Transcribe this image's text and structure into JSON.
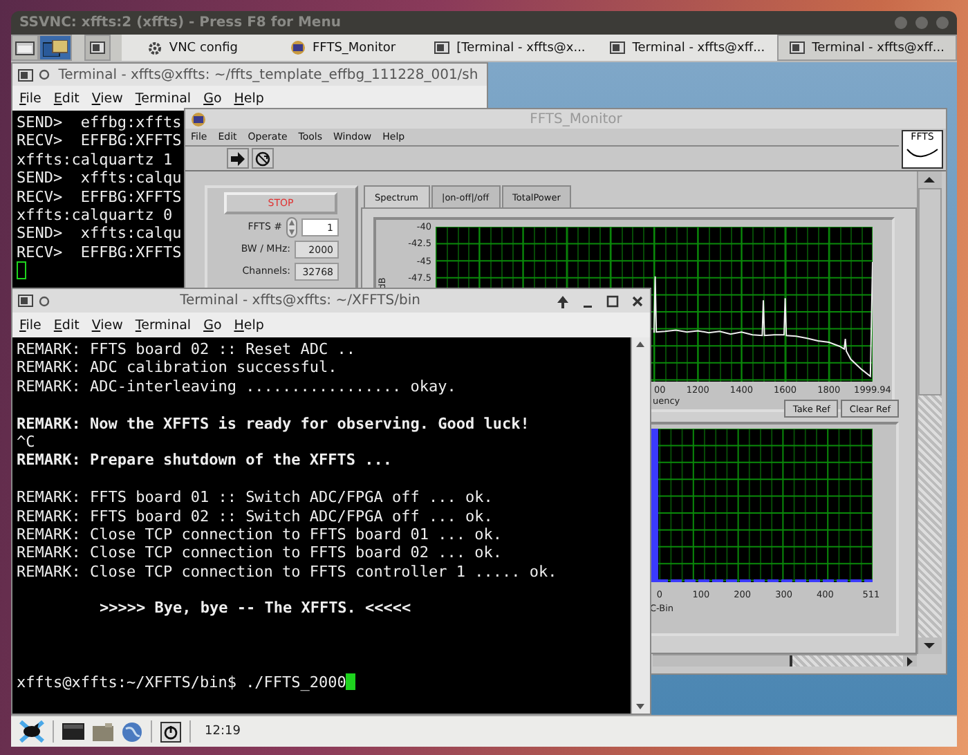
{
  "vnc_window": {
    "title": "SSVNC: xffts:2 (xffts) - Press F8 for Menu"
  },
  "top_panel": {
    "tasks": [
      {
        "kind": "settings",
        "label": "VNC config",
        "selected": false
      },
      {
        "kind": "app",
        "label": "FFTS_Monitor",
        "selected": false
      },
      {
        "kind": "terminal",
        "label": "[Terminal - xffts@x...",
        "selected": false
      },
      {
        "kind": "terminal",
        "label": "Terminal - xffts@xff...",
        "selected": false
      },
      {
        "kind": "terminal",
        "label": "Terminal - xffts@xff...",
        "selected": true
      }
    ]
  },
  "terminal_back": {
    "title": "Terminal - xffts@xffts: ~/ffts_template_effbg_111228_001/sh",
    "menu": [
      "File",
      "Edit",
      "View",
      "Terminal",
      "Go",
      "Help"
    ],
    "lines": [
      {
        "text": "SEND>  effbg:xffts"
      },
      {
        "text": "RECV>  EFFBG:XFFTS"
      },
      {
        "text": "xffts:calquartz 1"
      },
      {
        "text": "SEND>  xffts:calqu"
      },
      {
        "text": "RECV>  EFFBG:XFFTS"
      },
      {
        "text": "xffts:calquartz 0"
      },
      {
        "text": "SEND>  xffts:calqu"
      },
      {
        "text": "RECV>  EFFBG:XFFTS"
      }
    ]
  },
  "monitor": {
    "title": "FFTS_Monitor",
    "menu": [
      "File",
      "Edit",
      "Operate",
      "Tools",
      "Window",
      "Help"
    ],
    "logo_text": "FFTS",
    "stop_button": "STOP",
    "fields": [
      {
        "kind": "spinner",
        "label": "FFTS #",
        "value": "1"
      },
      {
        "kind": "text",
        "label": "BW / MHz:",
        "value": "2000"
      },
      {
        "kind": "text",
        "label": "Channels:",
        "value": "32768"
      }
    ],
    "tabs": [
      {
        "label": "Spectrum",
        "selected": true
      },
      {
        "label": "|on-off|/off",
        "selected": false
      },
      {
        "label": "TotalPower",
        "selected": false
      }
    ],
    "spectrum": {
      "cut_tick_label": "00",
      "chart_data": {
        "type": "line",
        "grid": true,
        "xlabel": "uency",
        "ylabel": "dB",
        "xlim": [
          0,
          1999.94
        ],
        "ylim": [
          -62.8,
          -40
        ],
        "xticks": [
          1200,
          1400,
          1600,
          1800,
          1999.94
        ],
        "yticks": [
          -40,
          -42.5,
          -45,
          -47.5
        ],
        "x": [
          1000,
          1005,
          1010,
          1050,
          1100,
          1150,
          1200,
          1250,
          1300,
          1350,
          1400,
          1450,
          1495,
          1500,
          1505,
          1550,
          1595,
          1600,
          1605,
          1650,
          1700,
          1750,
          1800,
          1850,
          1870,
          1875,
          1880,
          1900,
          1950,
          1990,
          1999.94
        ],
        "series": [
          {
            "color": "#eeeeee",
            "values": [
              -55.6,
              -47.3,
              -55.5,
              -55.4,
              -55.2,
              -55.5,
              -55.3,
              -55.6,
              -55.4,
              -55.8,
              -55.5,
              -55.9,
              -56.0,
              -50.8,
              -56.0,
              -55.9,
              -55.9,
              -50.5,
              -56.0,
              -56.1,
              -56.4,
              -56.8,
              -57.0,
              -57.6,
              -58.0,
              -56.5,
              -58.3,
              -59.5,
              -61.0,
              -62.0,
              -45.2
            ]
          }
        ]
      }
    },
    "buttons": [
      "Take Ref",
      "Clear Ref"
    ],
    "bins": {
      "x_ticks": [
        "0",
        "100",
        "200",
        "300",
        "400",
        "511"
      ],
      "x_label": "C-Bin"
    }
  },
  "terminal_front": {
    "title": "Terminal - xffts@xffts: ~/XFFTS/bin",
    "menu": [
      "File",
      "Edit",
      "View",
      "Terminal",
      "Go",
      "Help"
    ],
    "blocks": [
      {
        "lines": [
          {
            "text": "REMARK: FFTS board 02 :: Reset ADC ..",
            "bold": false
          },
          {
            "text": "REMARK: ADC calibration successful.",
            "bold": false
          },
          {
            "text": "REMARK: ADC-interleaving ................. okay.",
            "bold": false
          }
        ]
      },
      {
        "lines": [
          {
            "text": "REMARK: Now the XFFTS is ready for observing. Good luck!",
            "bold": true
          },
          {
            "text": "^C",
            "bold": false
          },
          {
            "text": "REMARK: Prepare shutdown of the XFFTS ...",
            "bold": true
          }
        ]
      },
      {
        "lines": [
          {
            "text": "REMARK: FFTS board 01 :: Switch ADC/FPGA off ... ok.",
            "bold": false
          },
          {
            "text": "REMARK: FFTS board 02 :: Switch ADC/FPGA off ... ok.",
            "bold": false
          },
          {
            "text": "REMARK: Close TCP connection to FFTS board 01 ... ok.",
            "bold": false
          },
          {
            "text": "REMARK: Close TCP connection to FFTS board 02 ... ok.",
            "bold": false
          },
          {
            "text": "REMARK: Close TCP connection to FFTS controller 1 ..... ok.",
            "bold": false
          }
        ]
      }
    ],
    "farewell": ">>>>> Bye, bye -- The XFFTS. <<<<<",
    "prompt": "xffts@xffts:~/XFFTS/bin$ ./FFTS_2000"
  },
  "bottom_panel": {
    "clock": "12:19"
  }
}
